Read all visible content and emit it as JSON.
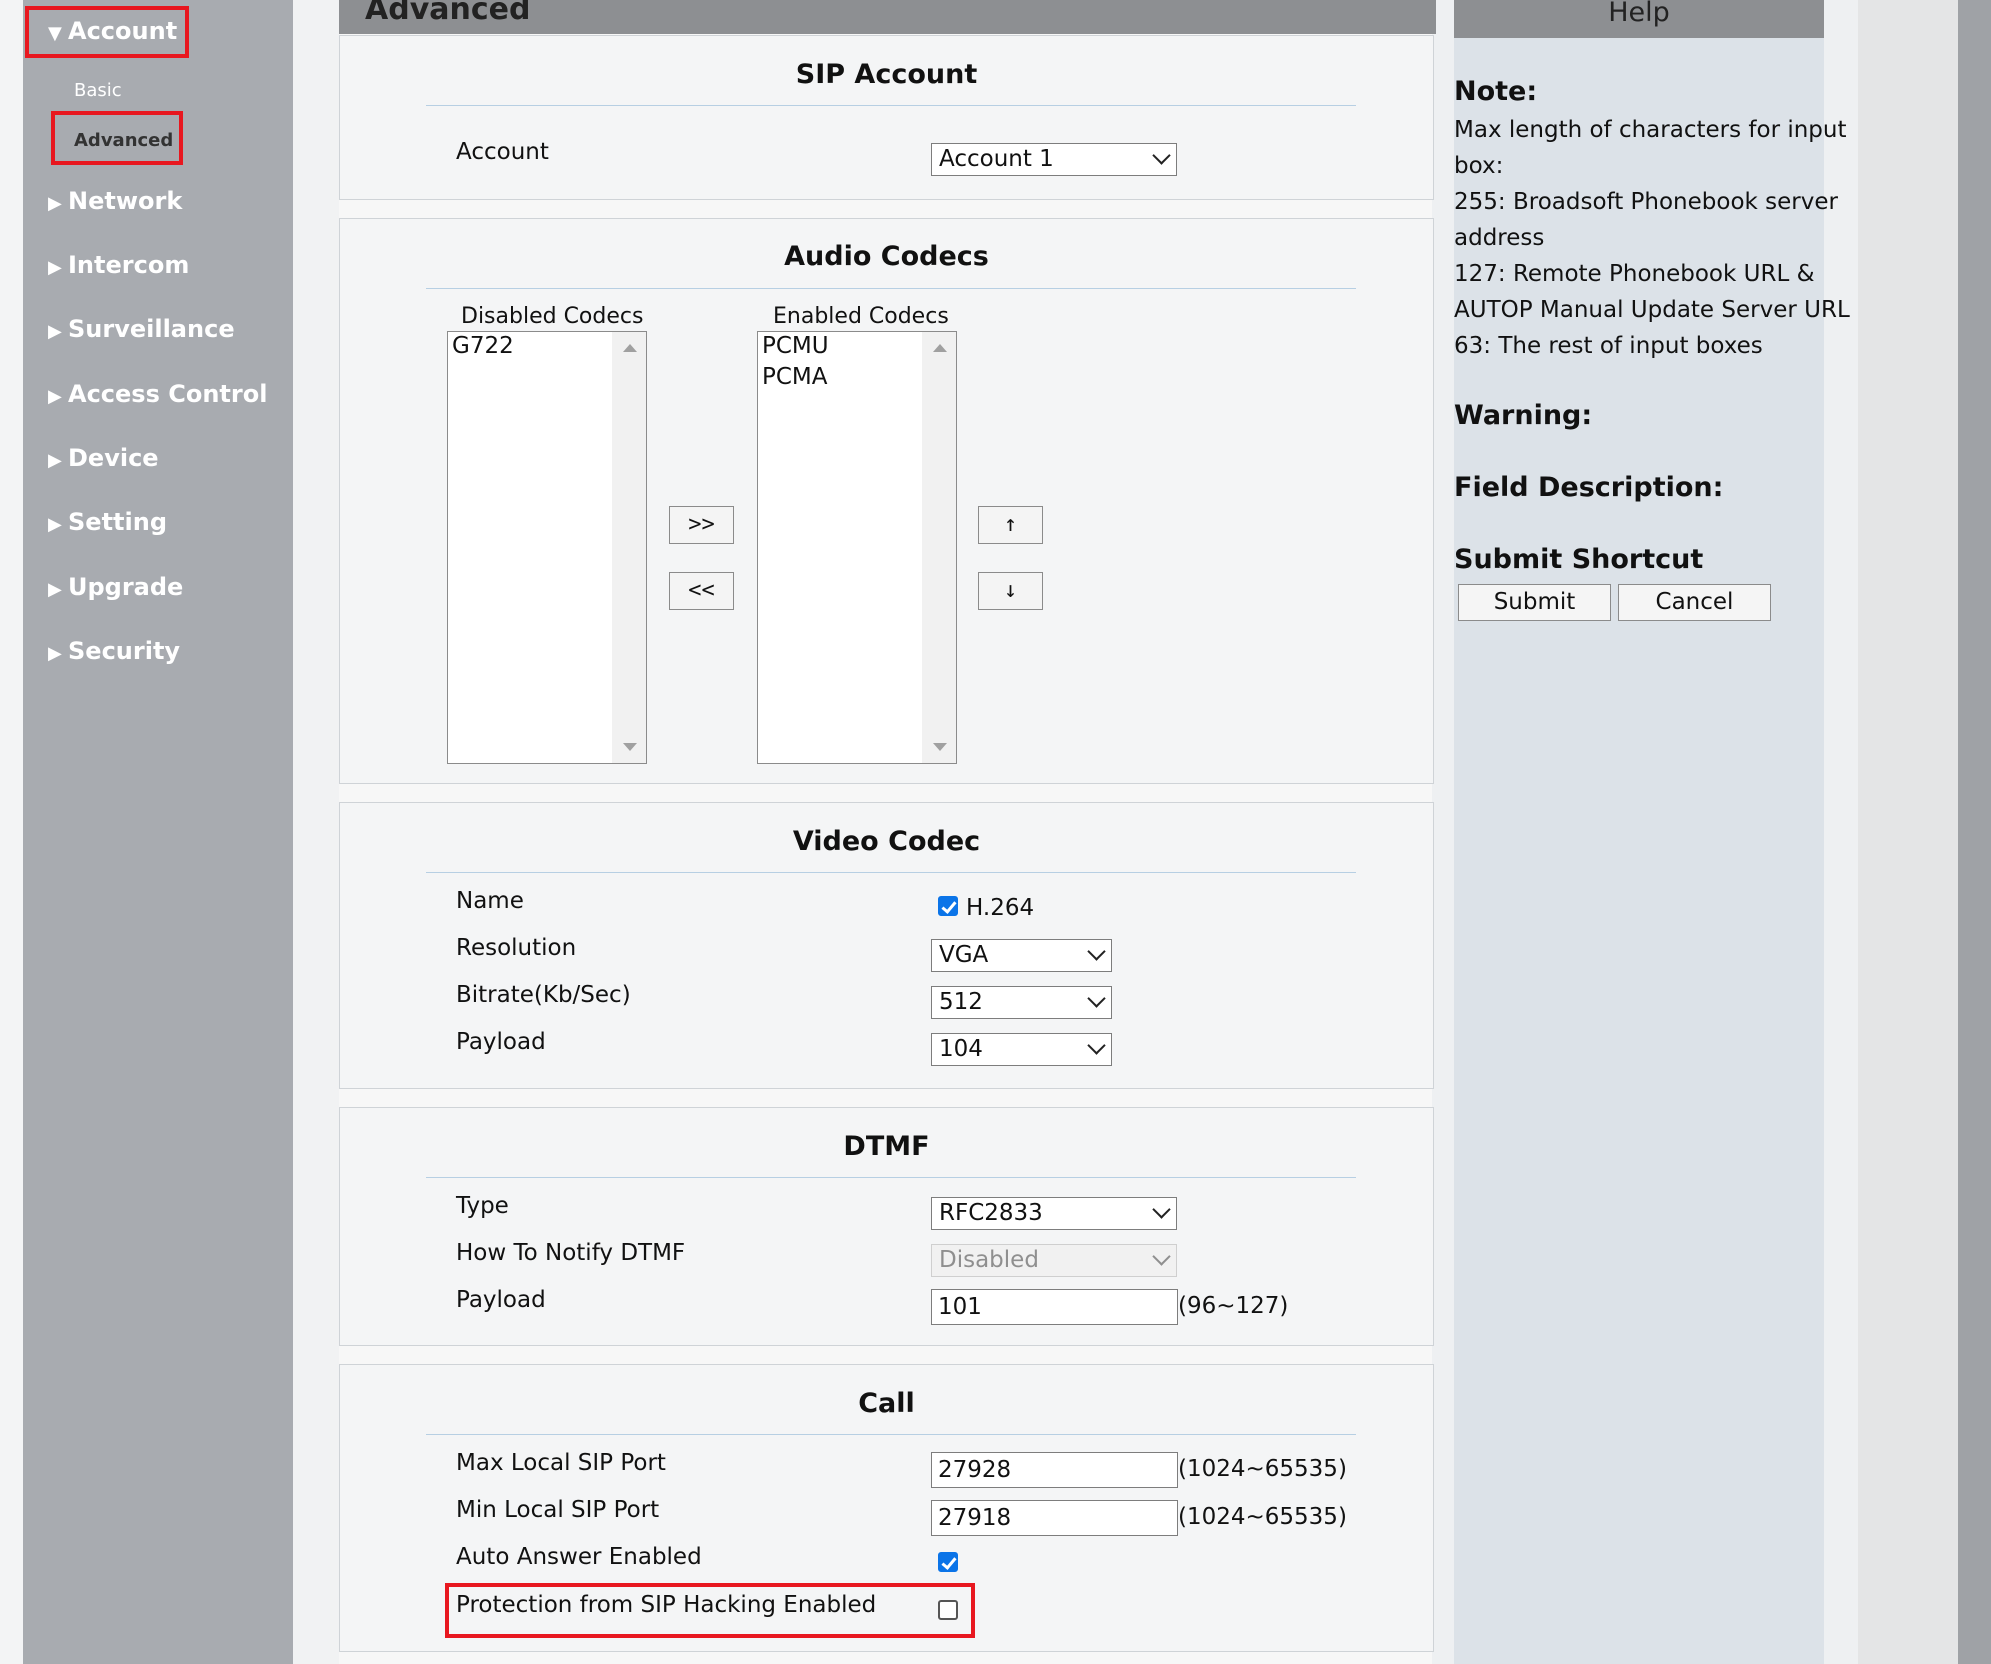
{
  "sidebar": {
    "items": [
      {
        "label": "Account",
        "arrow": "▼"
      },
      {
        "label": "Network",
        "arrow": "▶"
      },
      {
        "label": "Intercom",
        "arrow": "▶"
      },
      {
        "label": "Surveillance",
        "arrow": "▶"
      },
      {
        "label": "Access Control",
        "arrow": "▶"
      },
      {
        "label": "Device",
        "arrow": "▶"
      },
      {
        "label": "Setting",
        "arrow": "▶"
      },
      {
        "label": "Upgrade",
        "arrow": "▶"
      },
      {
        "label": "Security",
        "arrow": "▶"
      }
    ],
    "sub_items": [
      {
        "label": "Basic"
      },
      {
        "label": "Advanced"
      }
    ]
  },
  "header": {
    "title": "Advanced"
  },
  "sip_account": {
    "title": "SIP Account",
    "account_label": "Account",
    "account_value": "Account 1"
  },
  "audio_codecs": {
    "title": "Audio Codecs",
    "disabled_label": "Disabled Codecs",
    "enabled_label": "Enabled Codecs",
    "disabled": [
      "G722"
    ],
    "enabled": [
      "PCMU",
      "PCMA"
    ],
    "add_btn": ">>",
    "remove_btn": "<<",
    "up_btn": "↑",
    "down_btn": "↓"
  },
  "video_codec": {
    "title": "Video Codec",
    "name_label": "Name",
    "name_value": "H.264",
    "name_checked": true,
    "resolution_label": "Resolution",
    "resolution_value": "VGA",
    "bitrate_label": "Bitrate(Kb/Sec)",
    "bitrate_value": "512",
    "payload_label": "Payload",
    "payload_value": "104"
  },
  "dtmf": {
    "title": "DTMF",
    "type_label": "Type",
    "type_value": "RFC2833",
    "notify_label": "How To Notify DTMF",
    "notify_value": "Disabled",
    "payload_label": "Payload",
    "payload_value": "101",
    "payload_range": "(96~127)"
  },
  "call": {
    "title": "Call",
    "max_port_label": "Max Local SIP Port",
    "max_port_value": "27928",
    "max_port_range": "(1024~65535)",
    "min_port_label": "Min Local SIP Port",
    "min_port_value": "27918",
    "min_port_range": "(1024~65535)",
    "auto_answer_label": "Auto Answer Enabled",
    "auto_answer_checked": true,
    "protection_label": "Protection from SIP Hacking Enabled",
    "protection_checked": false
  },
  "help": {
    "title": "Help",
    "note_heading": "Note:",
    "note_lines": [
      "Max length of characters for input",
      "box:",
      "255: Broadsoft Phonebook server",
      "address",
      "127: Remote Phonebook URL &",
      "AUTOP Manual Update Server URL",
      "63: The rest of input boxes"
    ],
    "warning_heading": "Warning:",
    "field_heading": "Field Description:",
    "shortcut_heading": "Submit Shortcut",
    "submit_label": "Submit",
    "cancel_label": "Cancel"
  },
  "colors": {
    "sidebar_bg": "#a8abb0",
    "highlight_red": "#e8171f",
    "checkbox_blue": "#0b74e8",
    "header_gray": "#8d8f92",
    "help_bg": "#dce2e8"
  }
}
